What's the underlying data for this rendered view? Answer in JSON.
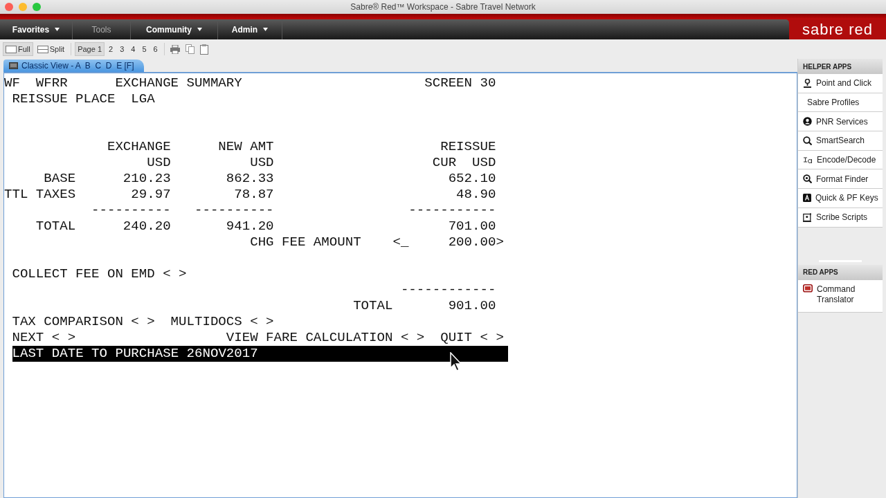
{
  "window": {
    "title": "Sabre® Red™ Workspace - Sabre Travel Network"
  },
  "logo": "sabre red",
  "menu": [
    {
      "label": "Favorites",
      "has_menu": true,
      "disabled": false
    },
    {
      "label": "Tools",
      "has_menu": false,
      "disabled": true
    },
    {
      "label": "Community",
      "has_menu": true,
      "disabled": false
    },
    {
      "label": "Admin",
      "has_menu": true,
      "disabled": false
    }
  ],
  "layout_buttons": [
    {
      "label": "Full",
      "selected": true
    },
    {
      "label": "Split",
      "selected": false
    }
  ],
  "pages": [
    {
      "label": "Page 1",
      "selected": true
    },
    {
      "label": "2",
      "selected": false
    },
    {
      "label": "3",
      "selected": false
    },
    {
      "label": "4",
      "selected": false
    },
    {
      "label": "5",
      "selected": false
    },
    {
      "label": "6",
      "selected": false
    }
  ],
  "view_tab": {
    "label": "Classic View - A  B  C  D  E [F]"
  },
  "terminal": {
    "lines": [
      {
        "kind": "text",
        "text": "WF  WFRR      EXCHANGE SUMMARY                       SCREEN 30"
      },
      {
        "kind": "text",
        "text": " REISSUE PLACE  LGA"
      },
      {
        "kind": "blank"
      },
      {
        "kind": "blank"
      },
      {
        "kind": "text",
        "text": "             EXCHANGE      NEW AMT                     REISSUE"
      },
      {
        "kind": "text",
        "text": "                  USD          USD                    CUR  USD"
      },
      {
        "kind": "text",
        "text": "     BASE      210.23       862.33                      652.10"
      },
      {
        "kind": "text",
        "text": "TTL TAXES       29.97        78.87                       48.90"
      },
      {
        "kind": "text",
        "text": "           ----------   ----------                 -----------"
      },
      {
        "kind": "text",
        "text": "    TOTAL      240.20       941.20                      701.00"
      },
      {
        "kind": "text",
        "text": "                               CHG FEE AMOUNT    <_     200.00>"
      },
      {
        "kind": "blank"
      },
      {
        "kind": "text",
        "text": " COLLECT FEE ON EMD < >"
      },
      {
        "kind": "text",
        "text": "                                                  ------------"
      },
      {
        "kind": "text",
        "text": "                                            TOTAL       901.00"
      },
      {
        "kind": "text",
        "text": " TAX COMPARISON < >  MULTIDOCS < >"
      },
      {
        "kind": "text",
        "text": " NEXT < >                   VIEW FARE CALCULATION < >  QUIT < >"
      },
      {
        "kind": "highlight",
        "text": "LAST DATE TO PURCHASE 26NOV2017"
      }
    ]
  },
  "helper_apps": {
    "title": "HELPER APPS",
    "items": [
      {
        "label": "Point and Click"
      },
      {
        "label": "Sabre Profiles"
      },
      {
        "label": "PNR Services"
      },
      {
        "label": "SmartSearch"
      },
      {
        "label": "Encode/Decode"
      },
      {
        "label": "Format Finder"
      },
      {
        "label": "Quick & PF Keys"
      },
      {
        "label": "Scribe Scripts"
      }
    ]
  },
  "red_apps": {
    "title": "RED APPS",
    "items": [
      {
        "label": "Command Translator"
      }
    ]
  }
}
